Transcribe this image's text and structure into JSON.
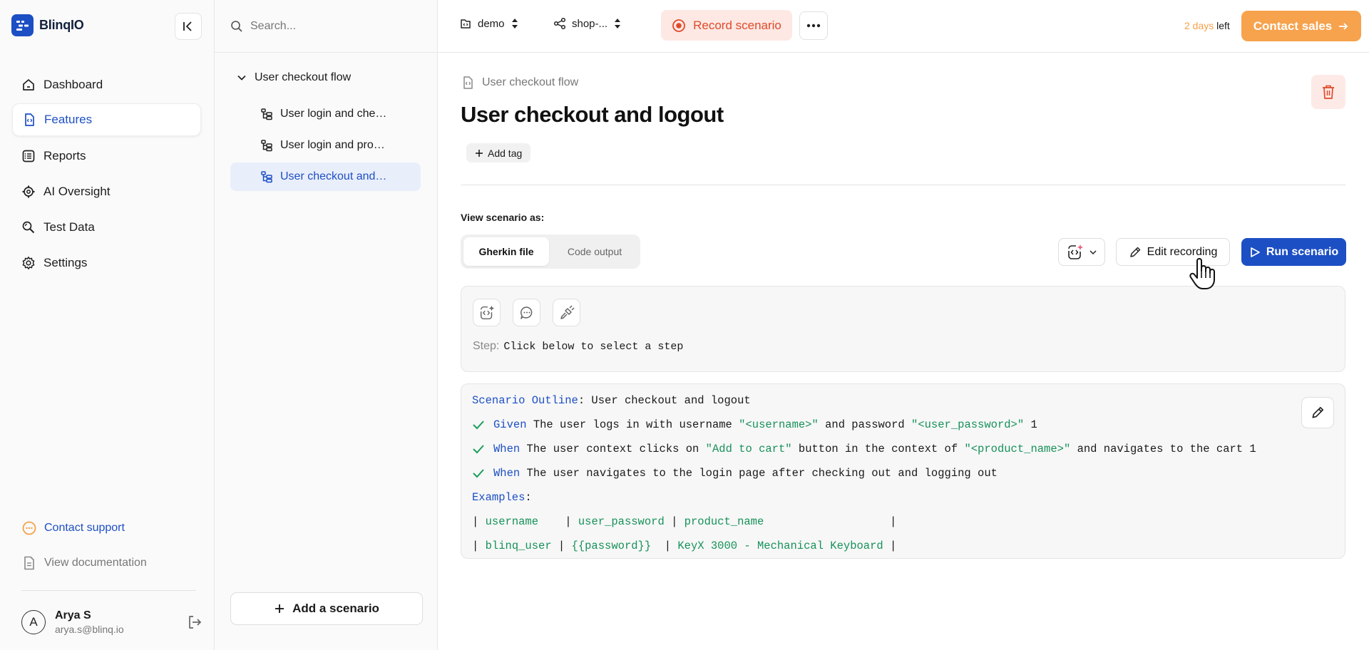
{
  "brand": {
    "name": "BlinqIO"
  },
  "sidebar": {
    "items": [
      {
        "label": "Dashboard",
        "icon": "home-icon",
        "active": false
      },
      {
        "label": "Features",
        "icon": "feature-file-icon",
        "active": true
      },
      {
        "label": "Reports",
        "icon": "list-icon",
        "active": false
      },
      {
        "label": "AI Oversight",
        "icon": "ai-gear-icon",
        "active": false
      },
      {
        "label": "Test Data",
        "icon": "search-data-icon",
        "active": false
      },
      {
        "label": "Settings",
        "icon": "gear-icon",
        "active": false
      }
    ],
    "contact_support": "Contact support",
    "view_documentation": "View documentation",
    "user": {
      "initial": "A",
      "name": "Arya S",
      "email": "arya.s@blinq.io"
    }
  },
  "tree": {
    "search_placeholder": "Search...",
    "folder": "User checkout flow",
    "items": [
      {
        "label": "User login and checkout",
        "active": false
      },
      {
        "label": "User login and product search",
        "active": false
      },
      {
        "label": "User checkout and logout",
        "active": true
      }
    ],
    "add_scenario": "Add a scenario"
  },
  "topbar": {
    "project": "demo",
    "app": "shop-...",
    "record": "Record scenario",
    "trial_count": "2 days",
    "trial_suffix": "left",
    "contact_sales": "Contact sales"
  },
  "main": {
    "breadcrumb": "User checkout flow",
    "title": "User checkout and logout",
    "add_tag": "Add tag",
    "view_label": "View scenario as:",
    "view_options": [
      "Gherkin file",
      "Code output"
    ],
    "edit_recording": "Edit recording",
    "run_scenario": "Run scenario",
    "step_label": "Step:",
    "step_value": "Click below to select a step"
  },
  "gherkin": {
    "outline_kw": "Scenario Outline",
    "outline_title": ": User checkout and logout",
    "steps": [
      {
        "kw": "Given",
        "parts": [
          {
            "t": " The user logs in with username ",
            "s": false
          },
          {
            "t": "\"<username>\"",
            "s": true
          },
          {
            "t": " and password ",
            "s": false
          },
          {
            "t": "\"<user_password>\"",
            "s": true
          },
          {
            "t": " 1",
            "s": false
          }
        ]
      },
      {
        "kw": "When",
        "parts": [
          {
            "t": " The user context clicks on ",
            "s": false
          },
          {
            "t": "\"Add to cart\"",
            "s": true
          },
          {
            "t": " button in the context of ",
            "s": false
          },
          {
            "t": "\"<product_name>\"",
            "s": true
          },
          {
            "t": " and navigates to the cart 1",
            "s": false
          }
        ]
      },
      {
        "kw": "When",
        "parts": [
          {
            "t": " The user navigates to the login page after checking out and logging out",
            "s": false
          }
        ]
      }
    ],
    "examples_kw": "Examples",
    "examples_colon": ":",
    "table_rows": [
      [
        "username   ",
        "user_password",
        "product_name                  "
      ],
      [
        "blinq_user",
        "{{password}} ",
        "KeyX 3000 - Mechanical Keyboard"
      ]
    ]
  }
}
